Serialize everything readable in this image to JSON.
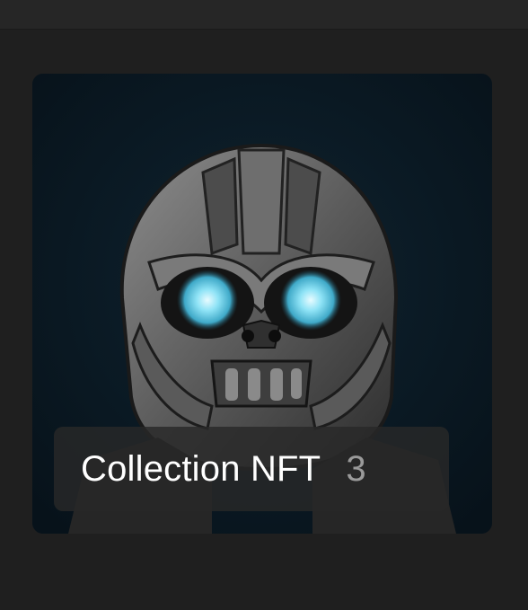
{
  "collection_card": {
    "title": "Collection NFT",
    "count": "3",
    "image_icon": "robot-skull-icon",
    "colors": {
      "background": "#1f1f1f",
      "card_bg": "#0b1820",
      "eye_glow": "#7fd8f0",
      "count_text": "#9a9a9a"
    }
  }
}
